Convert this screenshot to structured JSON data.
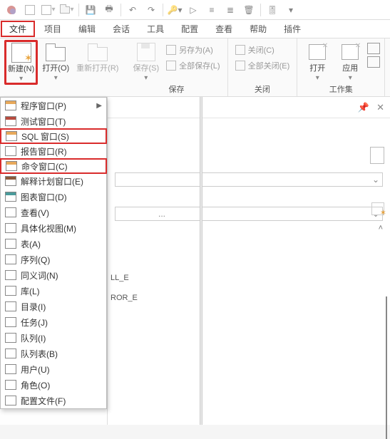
{
  "menu": {
    "items": [
      "文件",
      "项目",
      "编辑",
      "会话",
      "工具",
      "配置",
      "查看",
      "帮助",
      "插件"
    ],
    "active_index": 0
  },
  "ribbon": {
    "new_label": "新建(N)",
    "open_label": "打开(O)",
    "reopen_label": "重新打开(R)",
    "save_label": "保存(S)",
    "saveas_label": "另存为(A)",
    "saveall_label": "全部保存(L)",
    "close_label": "关闭(C)",
    "closeall_label": "全部关闭(E)",
    "open2_label": "打开",
    "apply_label": "应用",
    "group_save": "保存",
    "group_close": "关闭",
    "group_ws": "工作集"
  },
  "dropdown": {
    "items": [
      {
        "label": "程序窗口(P)",
        "color": "orange",
        "arrow": true
      },
      {
        "label": "测试窗口(T)",
        "color": "red"
      },
      {
        "label": "SQL 窗口(S)",
        "color": "orange",
        "hl": true
      },
      {
        "label": "报告窗口(R)",
        "color": "plain"
      },
      {
        "label": "命令窗口(C)",
        "color": "orange",
        "hl": true
      },
      {
        "label": "解释计划窗口(E)",
        "color": "brown"
      },
      {
        "label": "图表窗口(D)",
        "color": "teal"
      },
      {
        "label": "查看(V)",
        "color": "plain"
      },
      {
        "label": "具体化视图(M)",
        "color": "plain"
      },
      {
        "label": "表(A)",
        "color": "plain"
      },
      {
        "label": "序列(Q)",
        "color": "plain"
      },
      {
        "label": "同义词(N)",
        "color": "plain"
      },
      {
        "label": "库(L)",
        "color": "plain"
      },
      {
        "label": "目录(I)",
        "color": "plain"
      },
      {
        "label": "任务(J)",
        "color": "plain"
      },
      {
        "label": "队列(I)",
        "color": "plain"
      },
      {
        "label": "队列表(B)",
        "color": "plain"
      },
      {
        "label": "用户(U)",
        "color": "plain"
      },
      {
        "label": "角色(O)",
        "color": "plain"
      },
      {
        "label": "配置文件(F)",
        "color": "plain"
      }
    ]
  },
  "panel": {
    "txt1": "LL_E",
    "txt2": "ROR_E"
  }
}
